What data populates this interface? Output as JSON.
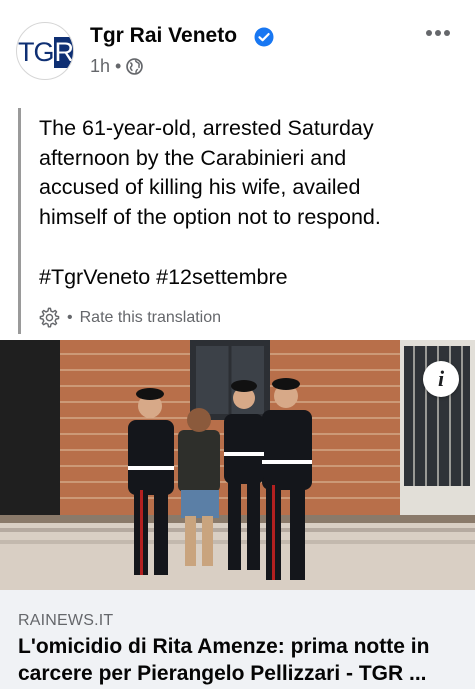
{
  "post": {
    "page_name": "Tgr Rai Veneto",
    "avatar_text": "TG",
    "avatar_text_r": "R",
    "time": "1h",
    "separator": "•",
    "privacy_icon": "globe-icon",
    "more_icon": "more-horizontal-icon",
    "verified_icon": "verified-badge-icon"
  },
  "content": {
    "line1": "The 61-year-old, arrested Saturday",
    "line2": "afternoon by the Carabinieri and",
    "line3": "accused of killing his wife, availed",
    "line4": "himself of the option not to respond.",
    "hashtags": "#TgrVeneto #12settembre",
    "translation_separator": "•",
    "rate_translation": "Rate this translation"
  },
  "link_card": {
    "domain": "RAINEWS.IT",
    "headline": "L'omicidio di Rita Amenze: prima notte in carcere per Pierangelo Pellizzari - TGR ...",
    "info_label": "i"
  },
  "colors": {
    "text": "#050505",
    "secondary": "#65676b",
    "verified": "#1877f2",
    "card_bg": "#f0f2f5"
  }
}
